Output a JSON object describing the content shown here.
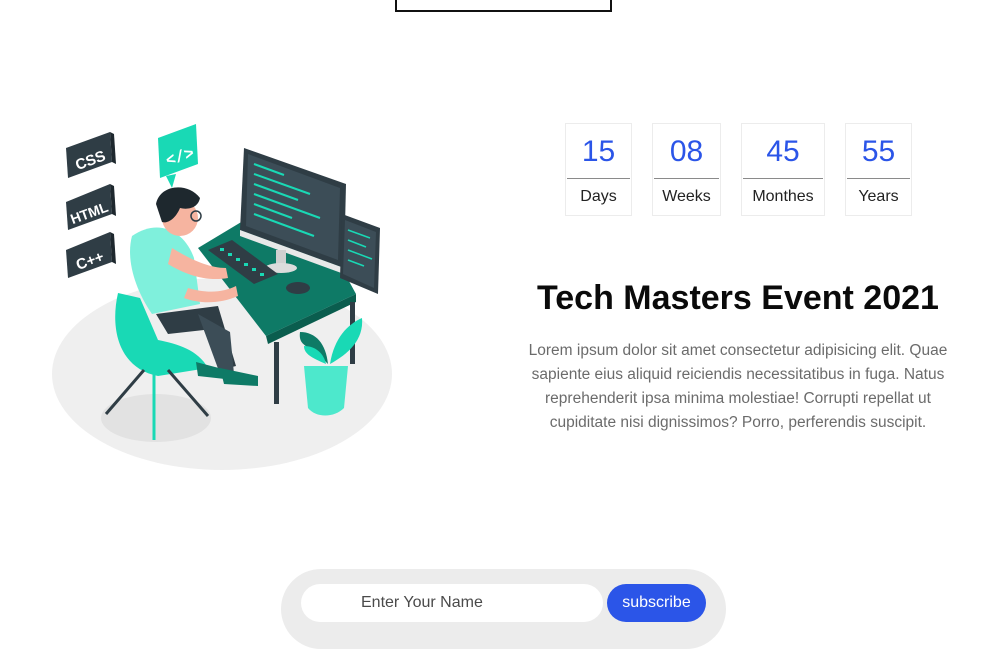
{
  "countdown": [
    {
      "value": "15",
      "label": "Days"
    },
    {
      "value": "08",
      "label": "Weeks"
    },
    {
      "value": "45",
      "label": "Monthes"
    },
    {
      "value": "55",
      "label": "Years"
    }
  ],
  "event": {
    "title": "Tech Masters Event 2021",
    "description": "Lorem ipsum dolor sit amet consectetur adipisicing elit. Quae sapiente eius aliquid reiciendis necessitatibus in fuga. Natus reprehenderit ipsa minima molestiae! Corrupti repellat ut cupiditate nisi dignissimos? Porro, perferendis suscipit."
  },
  "illustration": {
    "badges": [
      "CSS",
      "HTML",
      "C++"
    ],
    "code_badge": "</>"
  },
  "subscribe": {
    "placeholder": "Enter Your Name",
    "button_label": "subscribe"
  },
  "colors": {
    "accent": "#2b55e8",
    "teal": "#19d9b5",
    "dark_teal": "#0e7a66",
    "dark": "#2f3d45"
  }
}
